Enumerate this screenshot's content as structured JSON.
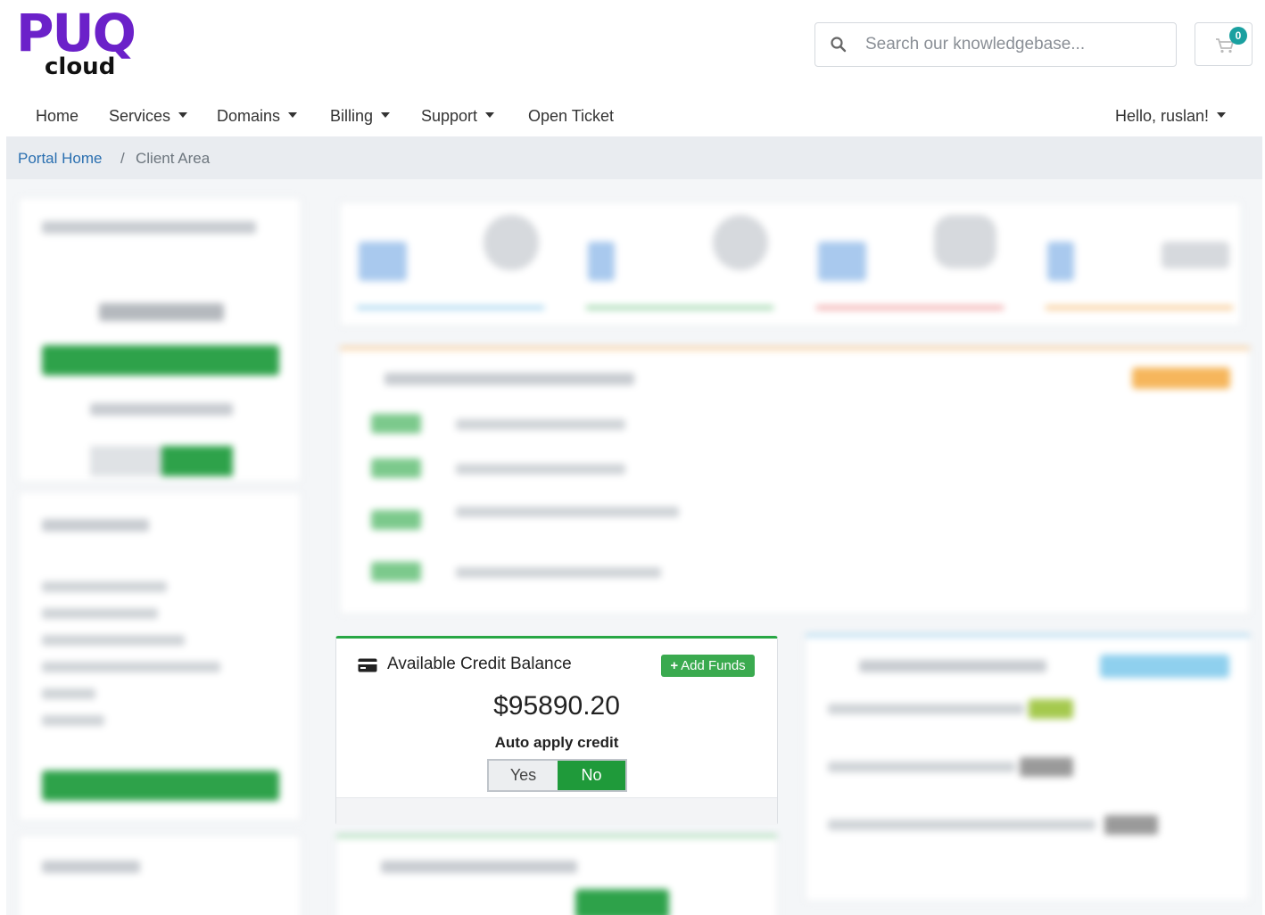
{
  "brand": {
    "logo_main": "PUQ",
    "logo_sub": "cloud"
  },
  "search": {
    "placeholder": "Search our knowledgebase..."
  },
  "cart": {
    "count": "0"
  },
  "nav": {
    "home": "Home",
    "services": "Services",
    "domains": "Domains",
    "billing": "Billing",
    "support": "Support",
    "open_ticket": "Open Ticket",
    "user": "Hello, ruslan!"
  },
  "breadcrumb": {
    "home": "Portal Home",
    "sep": "/",
    "current": "Client Area"
  },
  "credit_card": {
    "title": "Available Credit Balance",
    "add_funds": "Add Funds",
    "amount": "$95890.20",
    "auto_apply_label": "Auto apply credit",
    "yes": "Yes",
    "no": "No",
    "selected": "No"
  },
  "colors": {
    "brand": "#6b21c9",
    "success": "#28a745",
    "link": "#2a6fb0"
  }
}
